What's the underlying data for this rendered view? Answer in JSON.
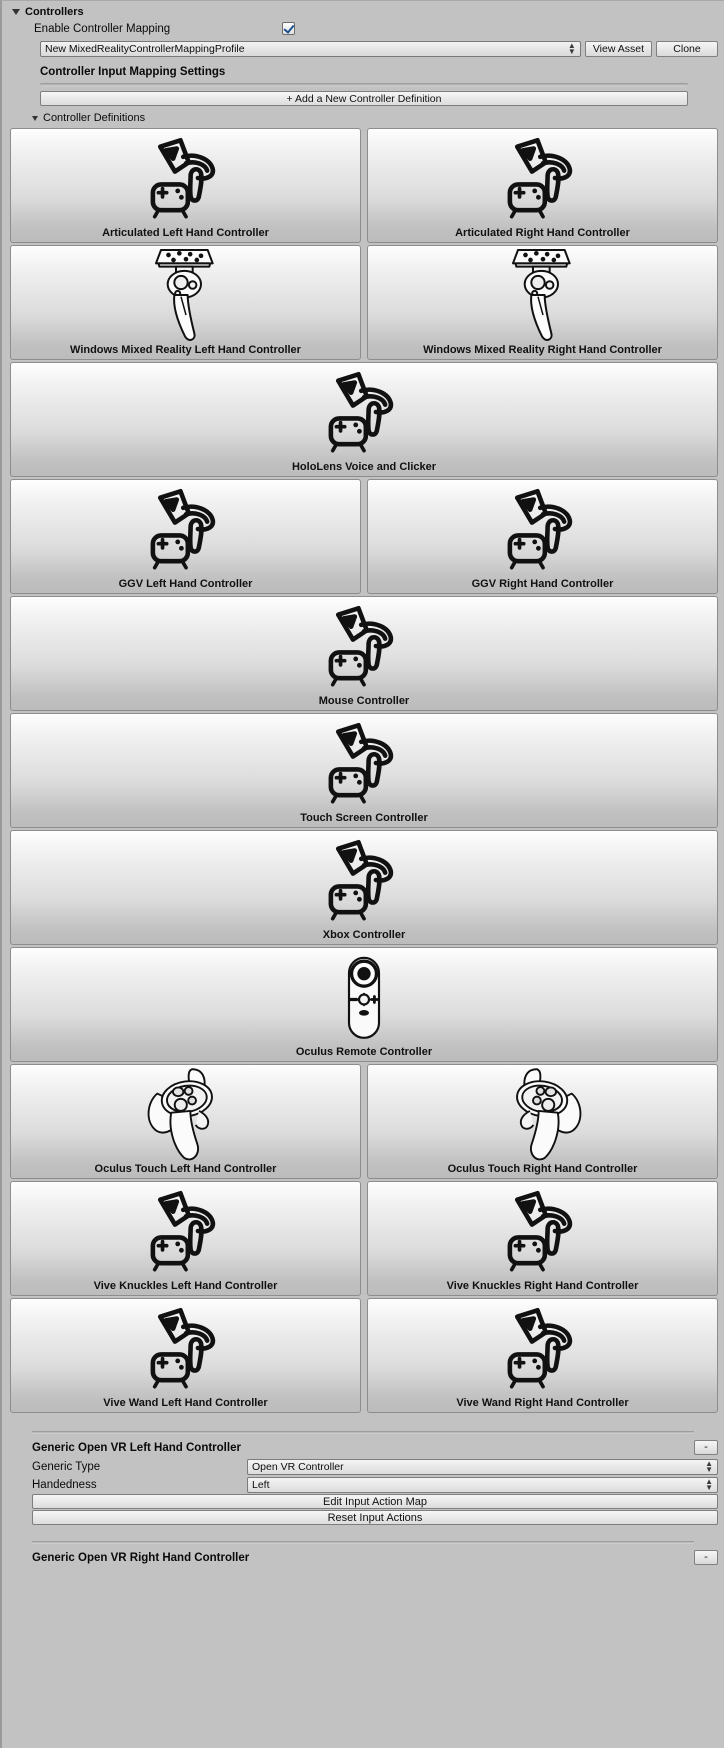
{
  "header": {
    "title": "Controllers",
    "enable_label": "Enable Controller Mapping",
    "enable_checked": true,
    "profile_value": "New MixedRealityControllerMappingProfile",
    "view_asset_label": "View Asset",
    "clone_label": "Clone",
    "section_title": "Controller Input Mapping Settings",
    "add_button_label": "+ Add a New Controller Definition",
    "definitions_label": "Controller Definitions"
  },
  "controllers": [
    {
      "label": "Articulated Left Hand Controller",
      "icon": "hand-gesture-icon",
      "full": false
    },
    {
      "label": "Articulated Right Hand Controller",
      "icon": "hand-gesture-icon",
      "full": false
    },
    {
      "label": "Windows Mixed Reality Left Hand Controller",
      "icon": "wmr-controller-icon",
      "full": false
    },
    {
      "label": "Windows Mixed Reality Right Hand Controller",
      "icon": "wmr-controller-icon",
      "full": false
    },
    {
      "label": "HoloLens Voice and Clicker",
      "icon": "hand-gesture-icon",
      "full": true
    },
    {
      "label": "GGV Left Hand Controller",
      "icon": "hand-gesture-icon",
      "full": false
    },
    {
      "label": "GGV Right Hand Controller",
      "icon": "hand-gesture-icon",
      "full": false
    },
    {
      "label": "Mouse Controller",
      "icon": "hand-gesture-icon",
      "full": true
    },
    {
      "label": "Touch Screen Controller",
      "icon": "hand-gesture-icon",
      "full": true
    },
    {
      "label": "Xbox Controller",
      "icon": "hand-gesture-icon",
      "full": true
    },
    {
      "label": "Oculus Remote Controller",
      "icon": "oculus-remote-icon",
      "full": true
    },
    {
      "label": "Oculus Touch Left Hand Controller",
      "icon": "oculus-touch-left-icon",
      "full": false
    },
    {
      "label": "Oculus Touch Right Hand Controller",
      "icon": "oculus-touch-right-icon",
      "full": false
    },
    {
      "label": "Vive Knuckles Left Hand Controller",
      "icon": "hand-gesture-icon",
      "full": false
    },
    {
      "label": "Vive Knuckles Right Hand Controller",
      "icon": "hand-gesture-icon",
      "full": false
    },
    {
      "label": "Vive Wand Left Hand Controller",
      "icon": "hand-gesture-icon",
      "full": false
    },
    {
      "label": "Vive Wand Right Hand Controller",
      "icon": "hand-gesture-icon",
      "full": false
    }
  ],
  "settings_blocks": [
    {
      "title": "Generic Open VR Left Hand Controller",
      "remove_label": "-",
      "generic_type_label": "Generic Type",
      "generic_type_value": "Open VR Controller",
      "handedness_label": "Handedness",
      "handedness_value": "Left",
      "edit_map_label": "Edit Input Action Map",
      "reset_label": "Reset Input Actions"
    },
    {
      "title": "Generic Open VR Right Hand Controller",
      "remove_label": "-"
    }
  ],
  "colors": {
    "window_bg": "#c2c2c2",
    "card_border": "#8d8d8d",
    "checkbox_check": "#1d4f91",
    "text": "#0a0a0a"
  }
}
